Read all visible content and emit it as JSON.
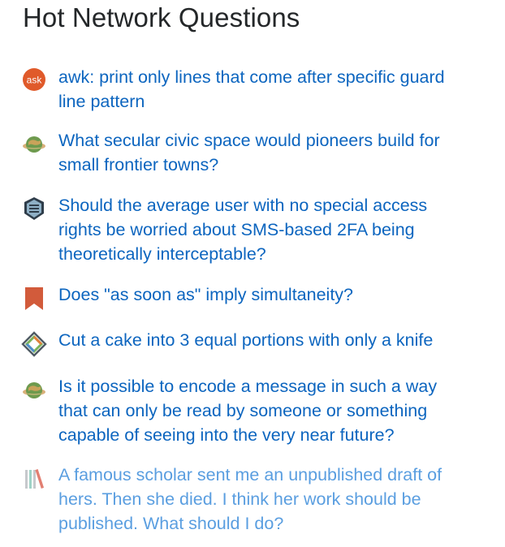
{
  "heading": "Hot Network Questions",
  "colors": {
    "link": "#0c65bf",
    "link_faded": "#5a9ee0",
    "heading": "#242729"
  },
  "questions": [
    {
      "site_icon": "ask-ubuntu-icon",
      "site_icon_text": "ask",
      "title": "awk: print only lines that come after specific guard\nline pattern"
    },
    {
      "site_icon": "worldbuilding-planet-icon",
      "title": "What secular civic space would pioneers build for\nsmall frontier towns?"
    },
    {
      "site_icon": "security-shield-icon",
      "title": "Should the average user with no special access\nrights be worried about SMS-based 2FA being\ntheoretically interceptable?"
    },
    {
      "site_icon": "english-bookmark-icon",
      "title": "Does \"as soon as\" imply simultaneity?"
    },
    {
      "site_icon": "puzzling-icon",
      "title": "Cut a cake into 3 equal portions with only a knife"
    },
    {
      "site_icon": "worldbuilding-planet-icon",
      "title": "Is it possible to encode a message in such a way\nthat can only be read by someone or something\ncapable of seeing into the very near future?"
    },
    {
      "site_icon": "academia-books-icon",
      "title": "A famous scholar sent me an unpublished draft of\nhers. Then she died. I think her work should be\npublished. What should I do?"
    }
  ]
}
